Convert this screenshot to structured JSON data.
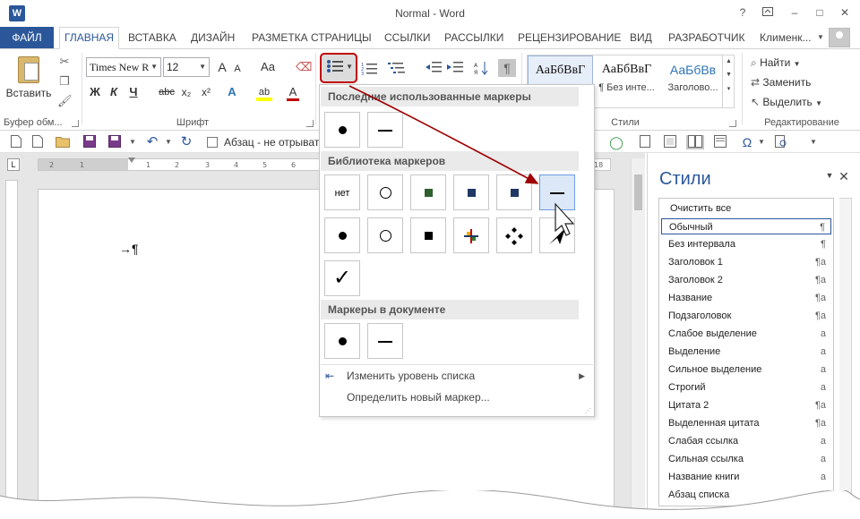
{
  "window": {
    "title": "Normal - Word",
    "app_icon": "W",
    "help_label": "?",
    "controls": [
      "?",
      "restore",
      "–",
      "□",
      "✕"
    ]
  },
  "tabs": {
    "file": "ФАЙЛ",
    "items": [
      "ГЛАВНАЯ",
      "ВСТАВКА",
      "ДИЗАЙН",
      "РАЗМЕТКА СТРАНИЦЫ",
      "ССЫЛКИ",
      "РАССЫЛКИ",
      "РЕЦЕНЗИРОВАНИЕ",
      "ВИД",
      "РАЗРАБОТЧИК"
    ],
    "active": "ГЛАВНАЯ",
    "user": "Клименк..."
  },
  "ribbon": {
    "clipboard": {
      "paste": "Вставить",
      "group": "Буфер обм..."
    },
    "font": {
      "name": "Times New R",
      "size": "12",
      "group": "Шрифт",
      "grow": "A",
      "shrink": "A",
      "case": "Aa",
      "bold": "Ж",
      "italic": "К",
      "underline": "Ч",
      "strike": "abc",
      "subscript": "x₂",
      "superscript": "x²",
      "effects": "A",
      "highlight": "ab",
      "color": "A"
    },
    "styles": {
      "group": "Стили",
      "samples": [
        {
          "sample": "АаБбВвГ",
          "caption": ""
        },
        {
          "sample": "АаБбВвГ",
          "caption": "¶ Без инте..."
        },
        {
          "sample": "АаБбВв",
          "caption": "Заголово..."
        }
      ]
    },
    "editing": {
      "group": "Редактирование",
      "find": "Найти",
      "replace": "Заменить",
      "select": "Выделить"
    }
  },
  "qat": {
    "keep_with_next": "Абзац - не отрыват"
  },
  "ruler": {
    "corner": "L",
    "labels": [
      "2",
      "1",
      "1",
      "2",
      "3",
      "4",
      "5",
      "6",
      "7",
      "8",
      "9",
      "10",
      "11",
      "12",
      "13",
      "14",
      "15",
      "16",
      "18"
    ]
  },
  "document": {
    "text": "→¶"
  },
  "bullet_menu": {
    "recent_header": "Последние использованные маркеры",
    "library_header": "Библиотека маркеров",
    "doc_header": "Маркеры в документе",
    "none_label": "нет",
    "checkmark": "✓",
    "change_level": "Изменить уровень списка",
    "define_new": "Определить новый маркер..."
  },
  "colors": {
    "accent": "#2b579a",
    "highlight_red": "#c00000",
    "bullet_green": "#2f5f2f",
    "bullet_navy": "#1f3864",
    "arrow": "#a00000"
  },
  "styles_pane": {
    "title": "Стили",
    "items": [
      {
        "name": "Очистить все",
        "mark": ""
      },
      {
        "name": "Обычный",
        "mark": "¶"
      },
      {
        "name": "Без интервала",
        "mark": "¶"
      },
      {
        "name": "Заголовок 1",
        "mark": "¶a"
      },
      {
        "name": "Заголовок 2",
        "mark": "¶a"
      },
      {
        "name": "Название",
        "mark": "¶a"
      },
      {
        "name": "Подзаголовок",
        "mark": "¶a"
      },
      {
        "name": "Слабое выделение",
        "mark": "a"
      },
      {
        "name": "Выделение",
        "mark": "a"
      },
      {
        "name": "Сильное выделение",
        "mark": "a"
      },
      {
        "name": "Строгий",
        "mark": "a"
      },
      {
        "name": "Цитата 2",
        "mark": "¶a"
      },
      {
        "name": "Выделенная цитата",
        "mark": "¶a"
      },
      {
        "name": "Слабая ссылка",
        "mark": "a"
      },
      {
        "name": "Сильная ссылка",
        "mark": "a"
      },
      {
        "name": "Название книги",
        "mark": "a"
      },
      {
        "name": "Абзац списка",
        "mark": "¶"
      }
    ],
    "selected": "Обычный"
  }
}
